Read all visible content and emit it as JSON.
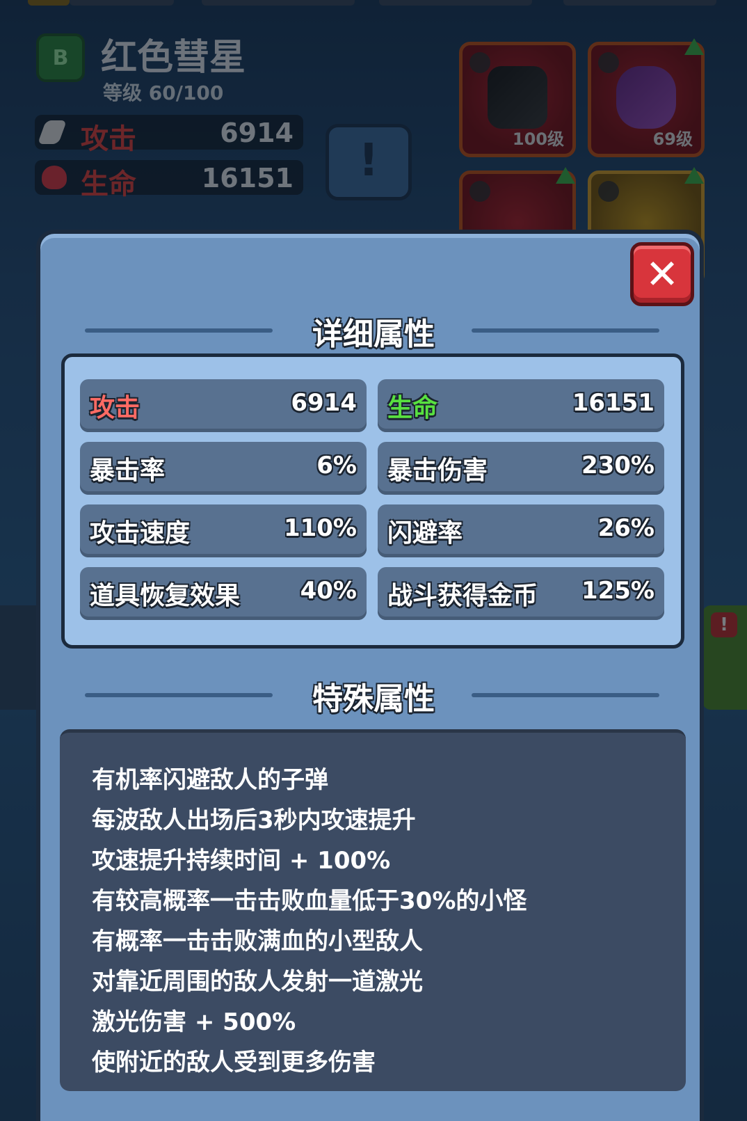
{
  "background": {
    "character": {
      "rank_badge": "B",
      "name": "红色彗星",
      "level": "等级 60/100"
    },
    "stats": [
      {
        "label": "攻击",
        "value": "6914",
        "color": "#e7443f",
        "icon": "bullet-icon"
      },
      {
        "label": "生命",
        "value": "16151",
        "color": "#e7443f",
        "icon": "heart-icon"
      }
    ],
    "info_button": "!",
    "equipment": [
      {
        "level": "100级",
        "icon": "gun-icon"
      },
      {
        "level": "69级",
        "icon": "armor-icon"
      }
    ],
    "side_alert": "!"
  },
  "modal": {
    "close_label": "✕",
    "detail_title": "详细属性",
    "attributes": [
      {
        "key": "攻击",
        "value": "6914",
        "key_color": "#ff6b64"
      },
      {
        "key": "生命",
        "value": "16151",
        "key_color": "#58e040"
      },
      {
        "key": "暴击率",
        "value": "6%",
        "key_color": "#ffffff"
      },
      {
        "key": "暴击伤害",
        "value": "230%",
        "key_color": "#ffffff"
      },
      {
        "key": "攻击速度",
        "value": "110%",
        "key_color": "#ffffff"
      },
      {
        "key": "闪避率",
        "value": "26%",
        "key_color": "#ffffff"
      },
      {
        "key": "道具恢复效果",
        "value": "40%",
        "key_color": "#ffffff"
      },
      {
        "key": "战斗获得金币",
        "value": "125%",
        "key_color": "#ffffff"
      }
    ],
    "special_title": "特殊属性",
    "special_attributes": [
      "有机率闪避敌人的子弹",
      "每波敌人出场后3秒内攻速提升",
      "攻速提升持续时间 + 100%",
      "有较高概率一击击败血量低于30%的小怪",
      "有概率一击击败满血的小型敌人",
      "对靠近周围的敌人发射一道激光",
      "激光伤害 + 500%",
      "使附近的敌人受到更多伤害"
    ]
  }
}
